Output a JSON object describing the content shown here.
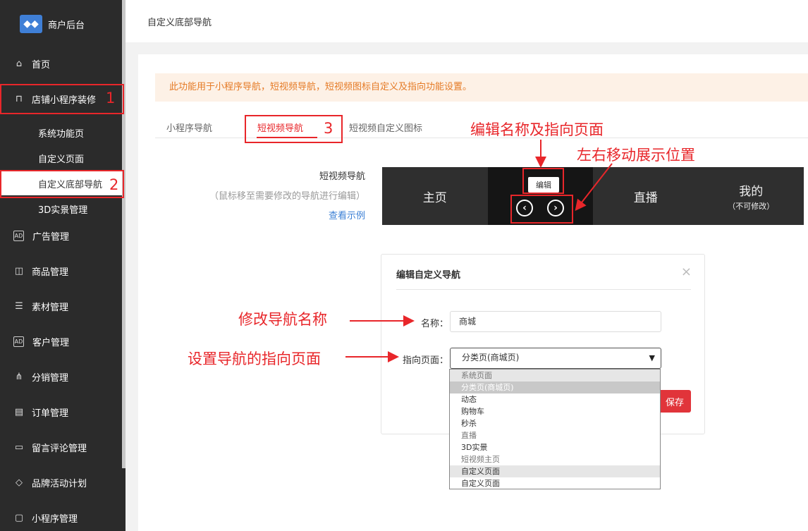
{
  "sidebar": {
    "brand": "商户后台",
    "items": [
      {
        "label": "首页",
        "icon": "home-icon"
      },
      {
        "label": "店铺小程序装修",
        "icon": "shop-icon"
      },
      {
        "label": "广告管理",
        "icon": "ad-icon"
      },
      {
        "label": "商品管理",
        "icon": "bag-icon"
      },
      {
        "label": "素材管理",
        "icon": "document-icon"
      },
      {
        "label": "客户管理",
        "icon": "ad-icon"
      },
      {
        "label": "分销管理",
        "icon": "network-icon"
      },
      {
        "label": "订单管理",
        "icon": "clipboard-icon"
      },
      {
        "label": "留言评论管理",
        "icon": "comment-icon"
      },
      {
        "label": "品牌活动计划",
        "icon": "tag-icon"
      },
      {
        "label": "小程序管理",
        "icon": "miniapp-icon"
      }
    ],
    "subitems": [
      "系统功能页",
      "自定义页面",
      "自定义底部导航",
      "3D实景管理"
    ]
  },
  "header": {
    "title": "自定义底部导航"
  },
  "notice": "此功能用于小程序导航，短视频导航，短视频图标自定义及指向功能设置。",
  "tabs": [
    "小程序导航",
    "短视频导航",
    "短视频自定义图标"
  ],
  "video_nav": {
    "label": "短视频导航",
    "hint": "（鼠标移至需要修改的导航进行编辑）",
    "example_link": "查看示例",
    "cells": [
      {
        "label": "主页",
        "sub": ""
      },
      {
        "label": "",
        "sub": ""
      },
      {
        "label": "直播",
        "sub": ""
      },
      {
        "label": "我的",
        "sub": "（不可修改）"
      }
    ],
    "edit_label": "编辑"
  },
  "modal": {
    "title": "编辑自定义导航",
    "name_label": "名称：",
    "name_value": "商城",
    "target_label": "指向页面：",
    "target_value": "分类页(商城页)",
    "save_label": "保存",
    "options": [
      "系统页面",
      "分类页(商城页)",
      "动态",
      "购物车",
      "秒杀",
      "直播",
      "3D实景",
      "短视频主页",
      "自定义页面",
      "自定义页面"
    ]
  },
  "annotations": {
    "edit_name": "编辑名称及指向页面",
    "move": "左右移动展示位置",
    "modify_name": "修改导航名称",
    "set_target": "设置导航的指向页面",
    "num1": "1",
    "num2": "2",
    "num3": "3"
  },
  "colors": {
    "accent": "#e8262a",
    "sidebar_bg": "#2b2b2b",
    "link": "#3a7fd5"
  }
}
